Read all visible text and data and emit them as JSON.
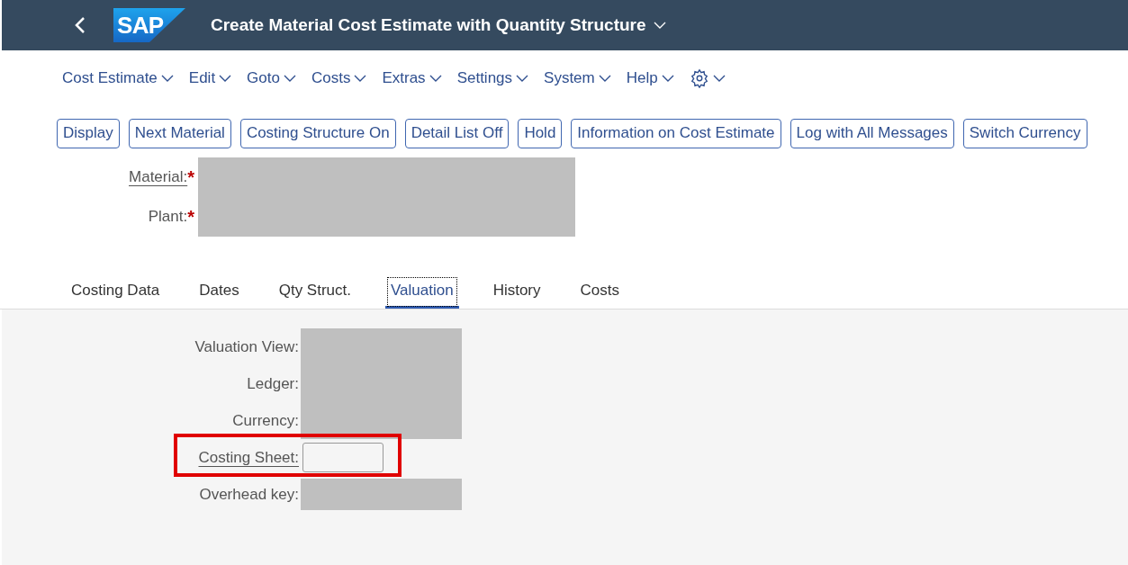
{
  "shell": {
    "logo": "SAP",
    "title": "Create Material Cost Estimate with Quantity Structure"
  },
  "menu": [
    "Cost Estimate",
    "Edit",
    "Goto",
    "Costs",
    "Extras",
    "Settings",
    "System",
    "Help"
  ],
  "toolbar": [
    "Display",
    "Next Material",
    "Costing Structure On",
    "Detail List Off",
    "Hold",
    "Information on Cost Estimate",
    "Log with All Messages",
    "Switch Currency"
  ],
  "header_fields": [
    {
      "label": "Material:",
      "required_mark": "*",
      "underlined": true
    },
    {
      "label": "Plant:",
      "required_mark": "*",
      "underlined": false
    }
  ],
  "tabs": [
    {
      "label": "Costing Data",
      "selected": false
    },
    {
      "label": "Dates",
      "selected": false
    },
    {
      "label": "Qty Struct.",
      "selected": false
    },
    {
      "label": "Valuation",
      "selected": true
    },
    {
      "label": "History",
      "selected": false
    },
    {
      "label": "Costs",
      "selected": false
    }
  ],
  "valuation_fields": [
    {
      "label": "Valuation View:",
      "kind": "redacted",
      "underlined": false,
      "highlighted": false
    },
    {
      "label": "Ledger:",
      "kind": "redacted",
      "underlined": false,
      "highlighted": false
    },
    {
      "label": "Currency:",
      "kind": "redacted",
      "underlined": false,
      "highlighted": false
    },
    {
      "label": "Costing Sheet:",
      "kind": "input",
      "underlined": true,
      "highlighted": true
    },
    {
      "label": "Overhead key:",
      "kind": "redacted",
      "underlined": false,
      "highlighted": false
    }
  ]
}
